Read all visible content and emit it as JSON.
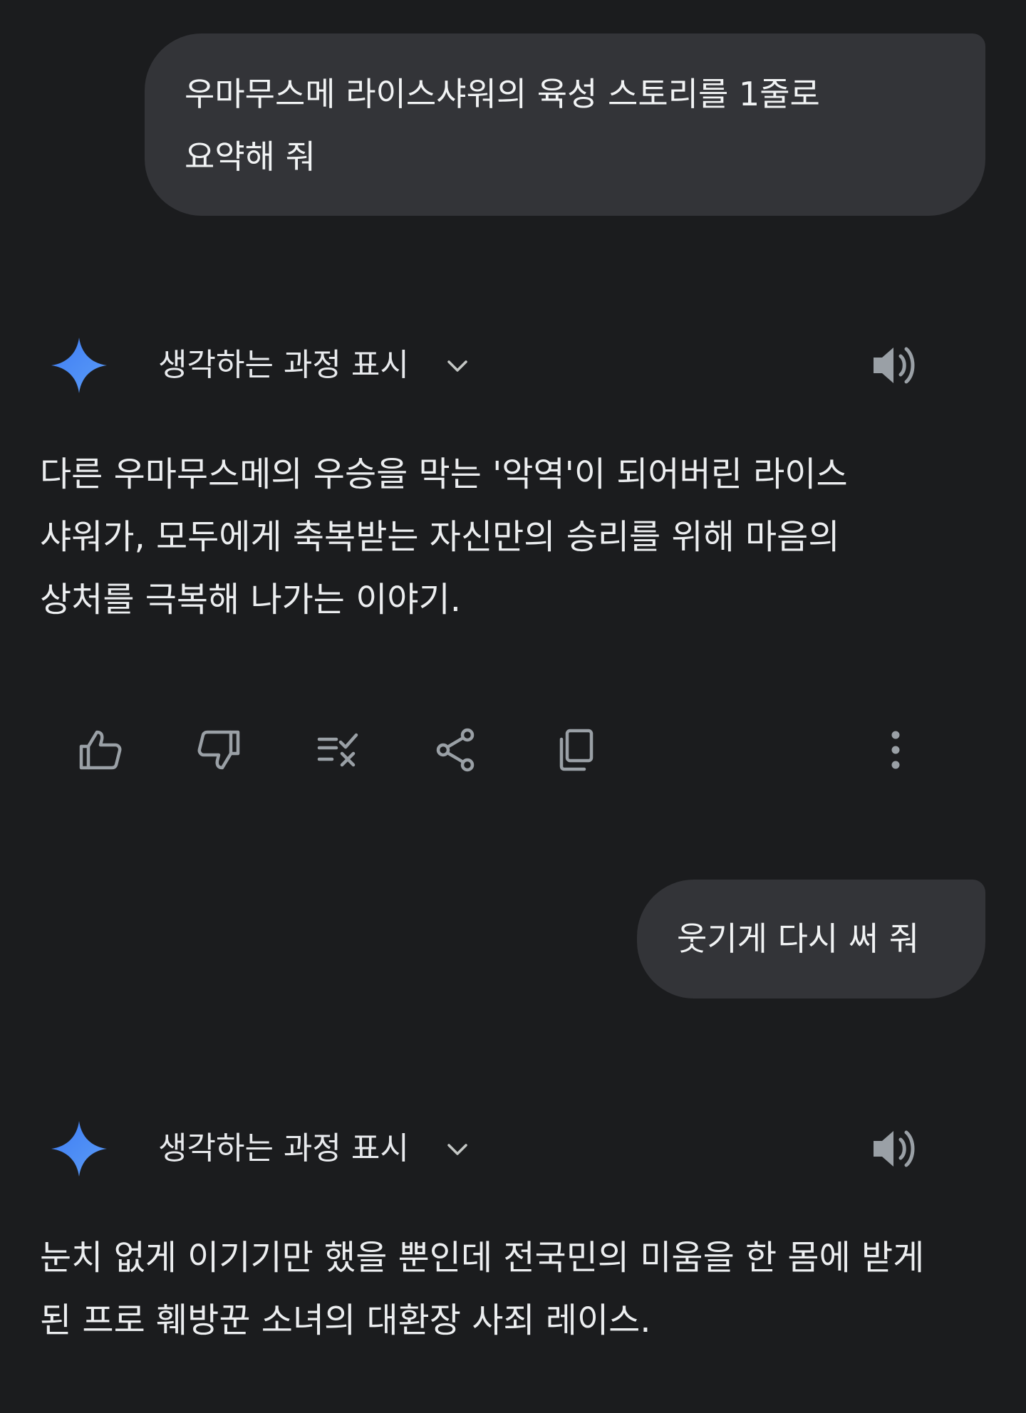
{
  "conversation": {
    "user_msg_1": {
      "line1": "우마무스메 라이스샤워의 육성 스토리를 1줄로",
      "line2": "요약해 줘"
    },
    "ai_1": {
      "show_thinking_label": "생각하는 과정 표시",
      "line1": "다른 우마무스메의 우승을 막는 '악역'이 되어버린 라이스",
      "line2": "샤워가, 모두에게 축복받는 자신만의 승리를 위해 마음의",
      "line3": "상처를 극복해 나가는 이야기."
    },
    "user_msg_2": {
      "text": "웃기게 다시 써 줘"
    },
    "ai_2": {
      "show_thinking_label": "생각하는 과정 표시",
      "line1": "눈치 없게 이기기만 했을 뿐인데 전국민의 미움을 한 몸에 받게",
      "line2": "된 프로 훼방꾼 소녀의 대환장 사죄 레이스."
    }
  },
  "icons": {
    "gemini": "gemini-spark-icon",
    "expand": "chevron-down-icon",
    "listen": "speaker-icon",
    "actions": [
      "thumbs-up-icon",
      "thumbs-down-icon",
      "double-check-icon",
      "share-icon",
      "copy-icon",
      "more-vert-icon"
    ]
  },
  "colors": {
    "background": "#1b1c1e",
    "user_bubble": "#333438",
    "icon_gray": "#9aa0a6",
    "gemini_blue": "#4285f4"
  }
}
